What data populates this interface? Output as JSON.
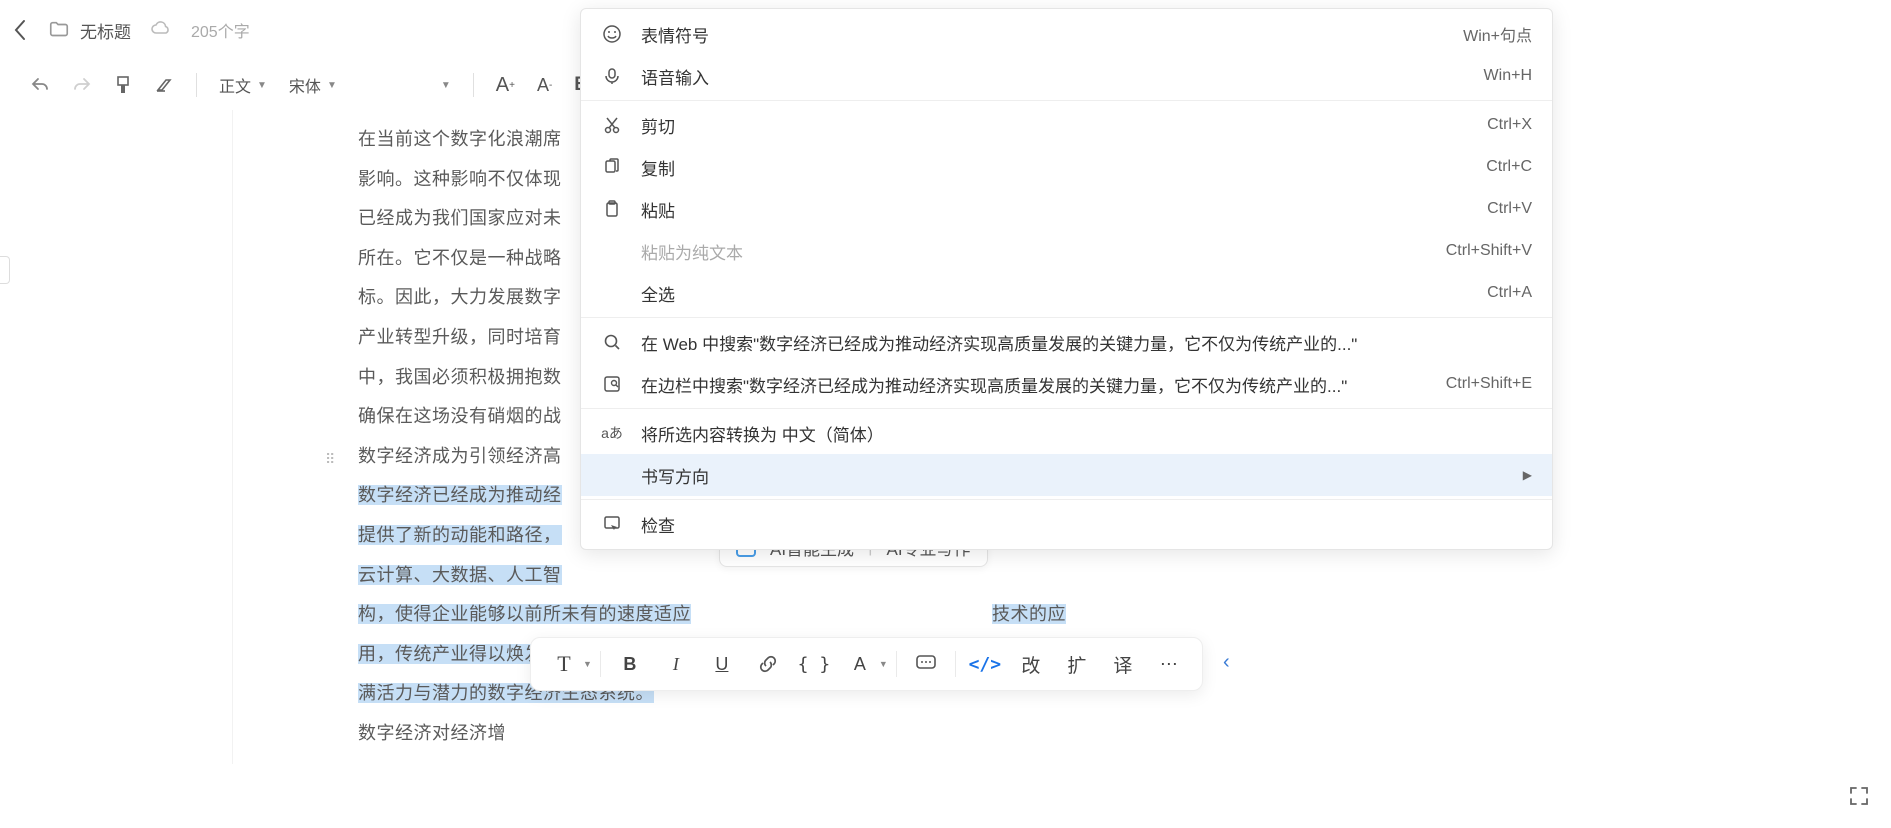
{
  "header": {
    "doc_title": "无标题",
    "word_count": "205个字"
  },
  "toolbar": {
    "style_label": "正文",
    "font_label": "宋体"
  },
  "document": {
    "para1": "在当前这个数字化浪潮席",
    "para2": "影响。这种影响不仅体现",
    "para3": "已经成为我们国家应对未",
    "para4": "所在。它不仅是一种战略",
    "para5": "标。因此，大力发展数字",
    "para6": "产业转型升级，同时培育",
    "para7": "中，我国必须积极拥抱数",
    "para8": "确保在这场没有硝烟的战",
    "heading": "数字经济成为引领经济高",
    "sel_pre": "数字经济已经成为推动经",
    "sel_l2": "提供了新的动能和路径，",
    "sel_l3": "云计算、大数据、人工智",
    "sel_l4a": "构，使得企业能够以前所未有的速度适应",
    "sel_l4b": "技术的应",
    "sel_l5": "用，传统产业得以焕发新生，而新兴产业则因技术创新而快速成长，共同构筑起一个充",
    "sel_l6": "满活力与潜力的数字经济生态系统。",
    "tail": "数字经济对经济增"
  },
  "ai_popup": {
    "gen": "AI智能生成",
    "write": "AI专业写作"
  },
  "context_menu": {
    "emoji": {
      "label": "表情符号",
      "shortcut": "Win+句点"
    },
    "voice": {
      "label": "语音输入",
      "shortcut": "Win+H"
    },
    "cut": {
      "label": "剪切",
      "shortcut": "Ctrl+X"
    },
    "copy": {
      "label": "复制",
      "shortcut": "Ctrl+C"
    },
    "paste": {
      "label": "粘贴",
      "shortcut": "Ctrl+V"
    },
    "paste_plain": {
      "label": "粘贴为纯文本",
      "shortcut": "Ctrl+Shift+V"
    },
    "select_all": {
      "label": "全选",
      "shortcut": "Ctrl+A"
    },
    "web_search": {
      "label": "在 Web 中搜索\"数字经济已经成为推动经济实现高质量发展的关键力量，它不仅为传统产业的...\""
    },
    "sidebar_search": {
      "label": "在边栏中搜索\"数字经济已经成为推动经济实现高质量发展的关键力量，它不仅为传统产业的...\"",
      "shortcut": "Ctrl+Shift+E"
    },
    "translate": {
      "label": "将所选内容转换为 中文（简体）"
    },
    "direction": {
      "label": "书写方向"
    },
    "inspect": {
      "label": "检查"
    }
  },
  "float_bar": {
    "change": "改",
    "expand": "扩",
    "translate": "译"
  }
}
